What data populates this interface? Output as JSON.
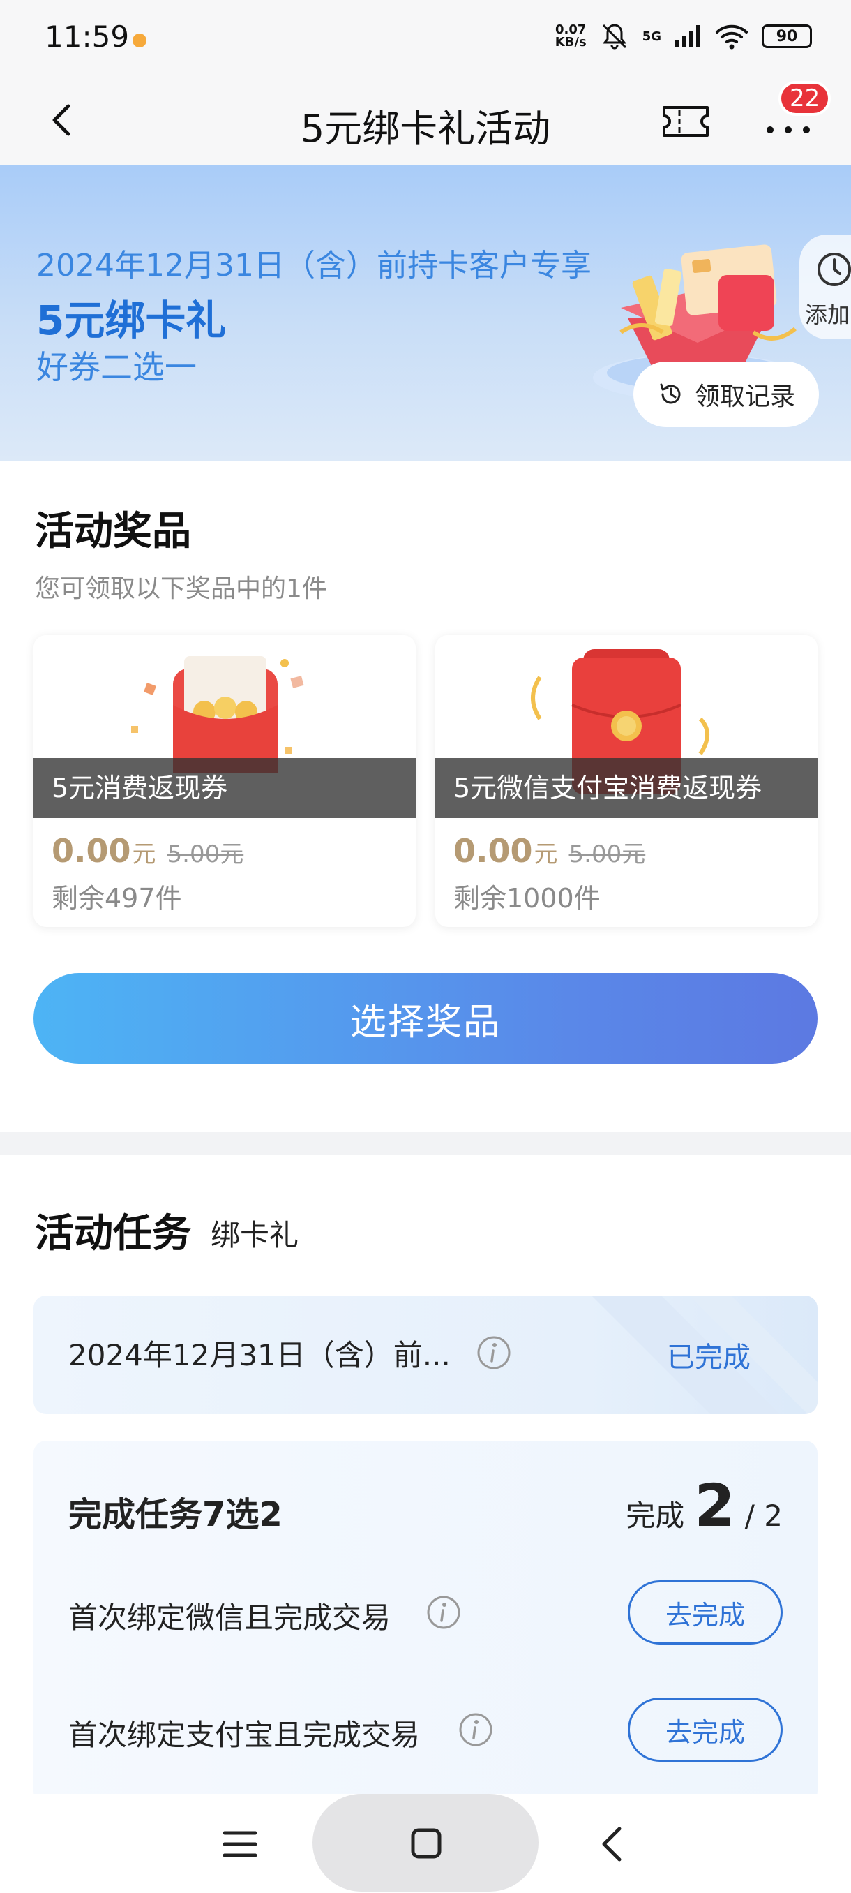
{
  "status_bar": {
    "time": "11:59",
    "net_speed_value": "0.07",
    "net_speed_unit": "KB/s",
    "signal_label": "5G",
    "battery": "90"
  },
  "nav": {
    "title": "5元绑卡礼活动",
    "badge_count": "22",
    "icons": [
      "back-icon",
      "ticket-icon",
      "more-icon"
    ]
  },
  "banner": {
    "line1": "2024年12月31日（含）前持卡客户专享",
    "line2": "5元绑卡礼",
    "line3": "好券二选一",
    "add_label": "添加",
    "records_label": "领取记录"
  },
  "prizes": {
    "title": "活动奖品",
    "subtitle": "您可领取以下奖品中的1件",
    "items": [
      {
        "name": "5元消费返现券",
        "price": "0.00",
        "unit": "元",
        "original": "5.00元",
        "remaining": "剩余497件"
      },
      {
        "name": "5元微信支付宝消费返现券",
        "price": "0.00",
        "unit": "元",
        "original": "5.00元",
        "remaining": "剩余1000件"
      }
    ],
    "select_label": "选择奖品"
  },
  "tasks": {
    "title": "活动任务",
    "tag": "绑卡礼",
    "row1": {
      "text": "2024年12月31日（含）前...",
      "status": "已完成"
    },
    "block": {
      "title": "完成任务7选2",
      "progress_label": "完成",
      "progress_done": "2",
      "progress_total": "/ 2",
      "items": [
        {
          "text": "首次绑定微信且完成交易",
          "button": "去完成"
        },
        {
          "text": "首次绑定支付宝且完成交易",
          "button": "去完成"
        }
      ]
    }
  },
  "colors": {
    "accent_blue": "#2f73d6",
    "badge_red": "#e8333a",
    "price_gold": "#b59a73"
  }
}
